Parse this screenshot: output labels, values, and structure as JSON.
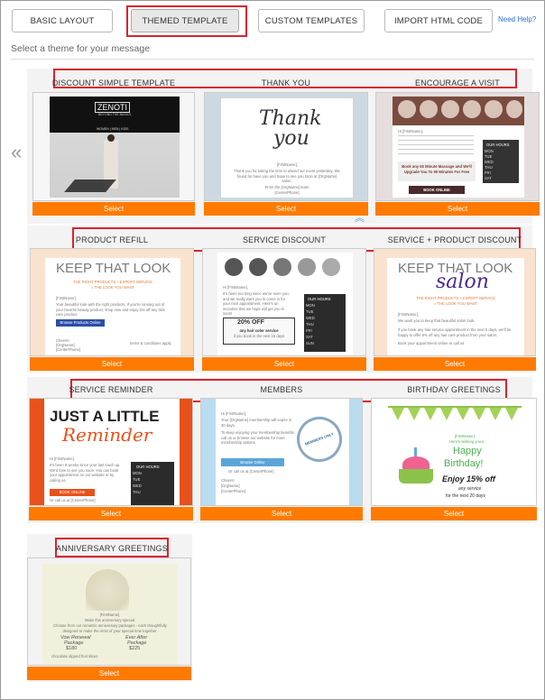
{
  "tabs": [
    {
      "label": "BASIC LAYOUT"
    },
    {
      "label": "THEMED TEMPLATE"
    },
    {
      "label": "CUSTOM TEMPLATES"
    },
    {
      "label": "IMPORT HTML CODE"
    }
  ],
  "help_link": "Need Help?",
  "subtitle": "Select a theme for your message",
  "select_label": "Select",
  "nav": {
    "left": "«",
    "right": "»",
    "collapse": "︽"
  },
  "templates": [
    {
      "name": "DISCOUNT SIMPLE TEMPLATE",
      "preview": {
        "logo": "ZENOTI",
        "logo_sub": "BEYOND THE BASICS",
        "nav_text": "WOMEN | MEN | KIDS"
      }
    },
    {
      "name": "THANK YOU",
      "preview": {
        "script1": "Thank",
        "script2": "you",
        "greeting": "[FirstName],",
        "body": "Thank you for taking the time to attend our event yesterday. We found for have you and hope to see you soon at [OrgName] salon.",
        "from": "From the [OrgName] team",
        "phone": "[CenterPhone]"
      }
    },
    {
      "name": "ENCOURAGE A VISIT",
      "preview": {
        "greeting": "Hi [FirstName],",
        "hours_title": "OUR HOURS",
        "days": [
          "MON",
          "TUE",
          "WED",
          "THU",
          "FRI",
          "SAT",
          "SUN"
        ],
        "offer": "Book any 60 Minute Massage and We'll Upgrade You To 90 Minutes For Free",
        "button": "BOOK ONLINE"
      }
    },
    {
      "name": "PRODUCT REFILL",
      "preview": {
        "headline": "KEEP THAT LOOK",
        "tagline1": "THE RIGHT PRODUCTS + EXPERT SERVICE",
        "tagline2": "= THE LOOK YOU WANT",
        "greeting": "[FirstName],",
        "body": "Your beautiful look with the right products. If you're running out of your favorite beauty product, shop now and enjoy 5% off any skin care product.",
        "button": "Browse Products Online",
        "sign1": "Cheers!",
        "sign2": "[OrgName]",
        "sign3": "[CenterPhone]",
        "terms": "terms & conditions apply"
      }
    },
    {
      "name": "SERVICE DISCOUNT",
      "preview": {
        "greeting": "Hi [FirstName],",
        "body": "It's been too long since we've seen you, and we really want you to come in for your next appointment. Here's an incentive that we hope will get you in soon!",
        "hours_title": "OUR HOURS",
        "days": [
          "MON",
          "TUE",
          "WED",
          "THU",
          "FRI",
          "SAT",
          "SUN"
        ],
        "offer1": "20% OFF",
        "offer2": "any hair color service",
        "offer3": "if you book in the next 15 days"
      }
    },
    {
      "name": "SERVICE + PRODUCT DISCOUNT",
      "preview": {
        "headline": "KEEP THAT LOOK",
        "script": "salon",
        "tagline1": "THE RIGHT PRODUCTS + EXPERT SERVICE",
        "tagline2": "= THE LOOK YOU WANT",
        "greeting": "[FirstName],",
        "body": "We want you to keep that beautiful salon look.",
        "body2": "If you book any hair service appointment in the next 5 days, we'll be happy to offer 5% off any hair care product from your salon.",
        "body3": "Book your appointment online or call us"
      }
    },
    {
      "name": "SERVICE REMINDER",
      "preview": {
        "headline": "JUST A LITTLE",
        "script": "Reminder",
        "greeting": "Hi [FirstName],",
        "body": "It's been 8 weeks since your last touch up. We'd love to see you soon. You can book your appointment on our website or by calling us.",
        "hours_title": "OUR HOURS",
        "days": [
          "MON",
          "TUE",
          "WED",
          "THU"
        ],
        "button": "BOOK ONLINE",
        "call": "Or call us at [CenterPhone]"
      }
    },
    {
      "name": "MEMBERS",
      "preview": {
        "greeting": "Hi [FirstName],",
        "body": "Your [OrgName] membership will expire in 30 days.",
        "body2": "To keep enjoying your membership benefits, call us or browse our website for more membership options.",
        "stamp": "MEMBERS ONLY",
        "button": "Browse Online",
        "call": "Or call us at [CenterPhone]",
        "sign1": "Cheers!",
        "sign2": "[OrgName]",
        "sign3": "[CenterPhone]"
      }
    },
    {
      "name": "BIRTHDAY GREETINGS",
      "preview": {
        "greeting1": "[FirstName],",
        "greeting2": "Here's wishing you a",
        "happy": "Happy",
        "birthday": "Birthday!",
        "offer": "Enjoy 15% off",
        "any": "any service",
        "next": "for the next 20 days"
      }
    },
    {
      "name": "ANNIVERSARY GREETINGS",
      "preview": {
        "greeting": "[FirstName],",
        "line1": "Make this anniversary special.",
        "line2": "Choose from our romantic anniversary packages - each thoughtfully designed to make the most of your special time together.",
        "pkg1": "Vow Renewal",
        "pkg1b": "Package",
        "price1": "$180",
        "pkg2": "Ever After",
        "pkg2b": "Package",
        "price2": "$225",
        "note": "chocolate dipped fruit slices"
      }
    }
  ]
}
